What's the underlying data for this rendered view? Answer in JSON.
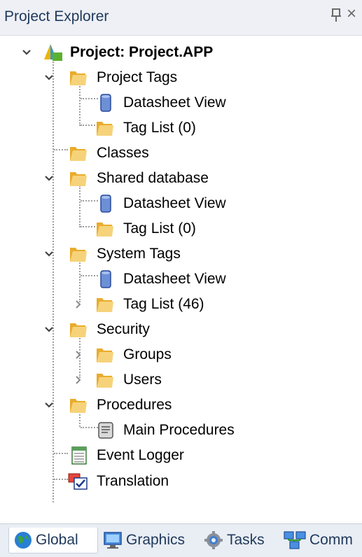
{
  "panel": {
    "title": "Project Explorer",
    "pin_icon": "pin-icon",
    "close_icon": "close-icon",
    "close_glyph": "×"
  },
  "tree": {
    "root": {
      "label": "Project: Project.APP",
      "expanded": true
    },
    "project_tags": {
      "label": "Project Tags",
      "expanded": true,
      "datasheet": "Datasheet View",
      "tag_list": "Tag List (0)"
    },
    "classes": {
      "label": "Classes"
    },
    "shared_database": {
      "label": "Shared database",
      "expanded": true,
      "datasheet": "Datasheet View",
      "tag_list": "Tag List (0)"
    },
    "system_tags": {
      "label": "System Tags",
      "expanded": true,
      "datasheet": "Datasheet View",
      "tag_list": "Tag List (46)"
    },
    "security": {
      "label": "Security",
      "expanded": true,
      "groups": "Groups",
      "users": "Users"
    },
    "procedures": {
      "label": "Procedures",
      "expanded": true,
      "main": "Main Procedures"
    },
    "event_logger": {
      "label": "Event Logger"
    },
    "translation": {
      "label": "Translation"
    }
  },
  "tabs": [
    {
      "label": "Global",
      "icon": "globe-icon",
      "active": true
    },
    {
      "label": "Graphics",
      "icon": "monitor-icon",
      "active": false
    },
    {
      "label": "Tasks",
      "icon": "gear-icon",
      "active": false
    },
    {
      "label": "Comm",
      "icon": "network-icon",
      "active": false
    }
  ],
  "colors": {
    "title_text": "#1e395b",
    "folder": "#f2c14e",
    "datasheet": "#6c8fd6"
  }
}
